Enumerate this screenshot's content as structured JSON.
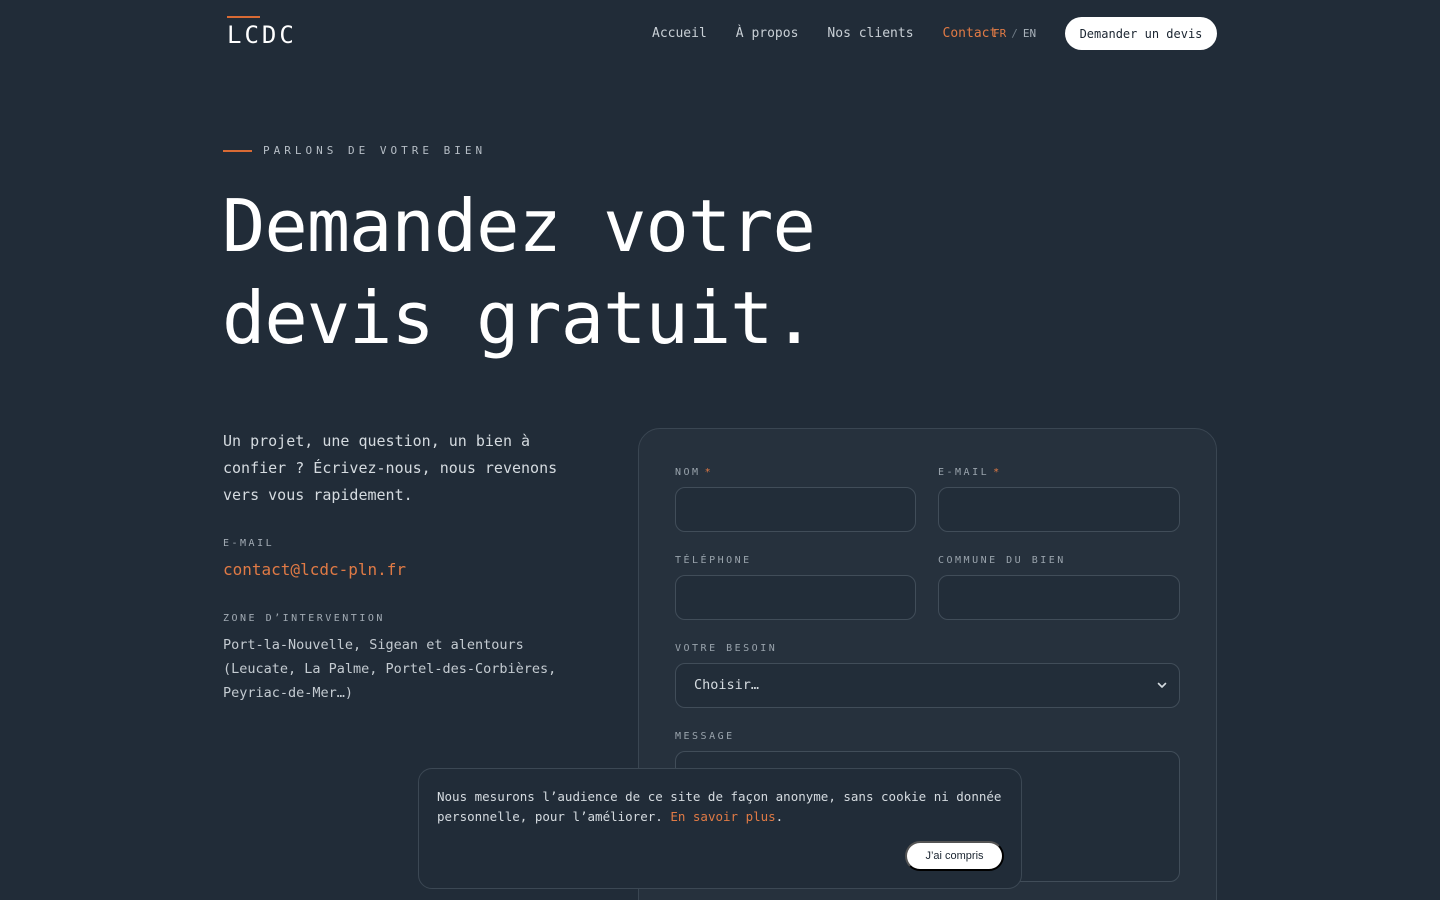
{
  "brand": {
    "logo": "LCDC"
  },
  "nav": {
    "items": [
      {
        "label": "Accueil",
        "active": false
      },
      {
        "label": "À propos",
        "active": false
      },
      {
        "label": "Nos clients",
        "active": false
      },
      {
        "label": "Contact",
        "active": true
      }
    ],
    "lang_fr": "FR",
    "lang_sep": "/",
    "lang_en": "EN",
    "cta": "Demander un devis"
  },
  "hero": {
    "eyebrow": "PARLONS DE VOTRE BIEN",
    "title_line1": "Demandez votre",
    "title_line2": "devis gratuit."
  },
  "contact": {
    "intro": "Un projet, une question, un bien à confier ? Écrivez-nous, nous revenons vers vous rapidement.",
    "email_label": "E-MAIL",
    "email": "contact@lcdc-pln.fr",
    "zone_label": "ZONE D’INTERVENTION",
    "zone_text": "Port-la-Nouvelle, Sigean et alentours (Leucate, La Palme, Portel-des-Corbières, Peyriac-de-Mer…)"
  },
  "form": {
    "nom_label": "NOM",
    "email_label": "E-MAIL",
    "required_mark": "*",
    "telephone_label": "TÉLÉPHONE",
    "commune_label": "COMMUNE DU BIEN",
    "besoin_label": "VOTRE BESOIN",
    "besoin_selected": "Choisir…",
    "message_label": "MESSAGE",
    "nom_value": "",
    "email_value": "",
    "telephone_value": "",
    "commune_value": ""
  },
  "cookie": {
    "text": "Nous mesurons l’audience de ce site de façon anonyme, sans cookie ni donnée personnelle, pour l’améliorer.",
    "link": "En savoir plus",
    "after_link": ".",
    "button": "J’ai compris"
  },
  "colors": {
    "background": "#212c38",
    "accent": "#e07a45"
  }
}
